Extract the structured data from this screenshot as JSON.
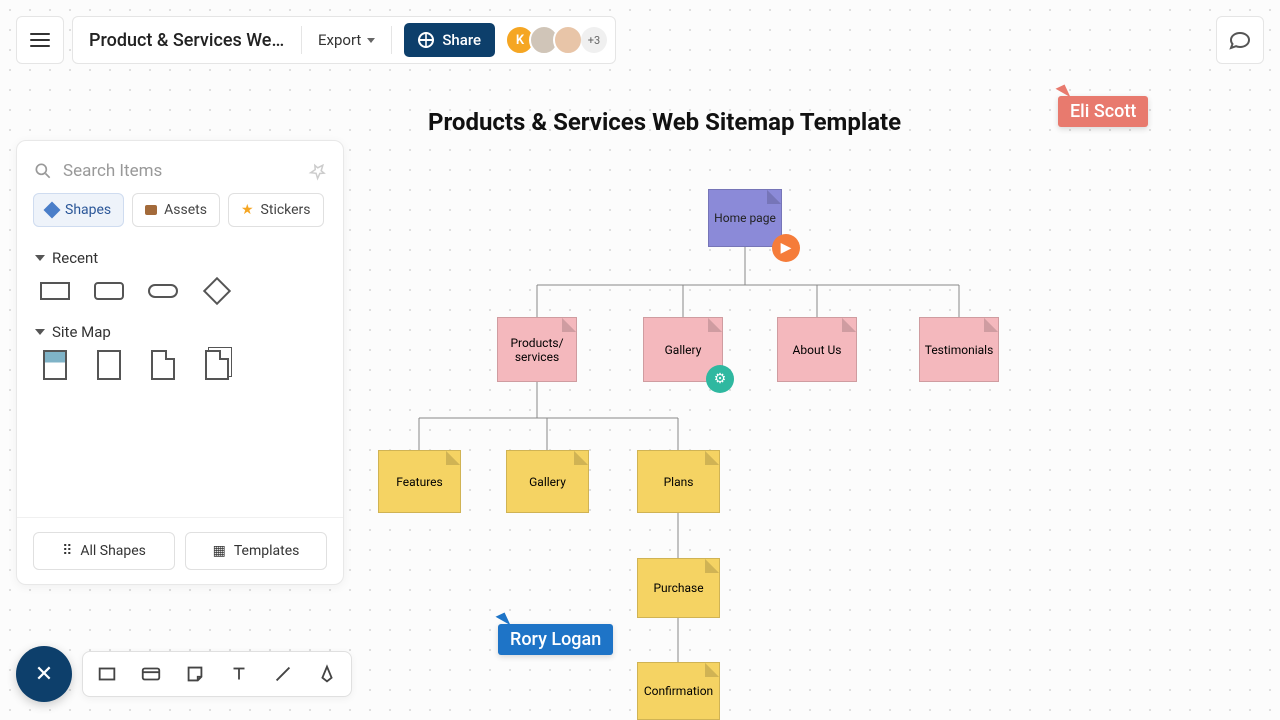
{
  "header": {
    "doc_title": "Product & Services Web...",
    "export_label": "Export",
    "share_label": "Share",
    "avatar_more": "+3",
    "avatar_initial": "K"
  },
  "sidebar": {
    "search_placeholder": "Search Items",
    "tabs": {
      "shapes": "Shapes",
      "assets": "Assets",
      "stickers": "Stickers"
    },
    "sections": {
      "recent": "Recent",
      "sitemap": "Site Map"
    },
    "footer": {
      "all_shapes": "All Shapes",
      "templates": "Templates"
    }
  },
  "canvas": {
    "title": "Products & Services Web Sitemap Template",
    "nodes": {
      "home": "Home page",
      "products": "Products/\nservices",
      "gallery": "Gallery",
      "about": "About Us",
      "testimonials": "Testimonials",
      "features": "Features",
      "gallery2": "Gallery",
      "plans": "Plans",
      "purchase": "Purchase",
      "confirmation": "Confirmation"
    }
  },
  "cursors": {
    "eli": "Eli Scott",
    "rory": "Rory Logan"
  },
  "colors": {
    "purple": "#8b8ad8",
    "pink": "#f4b8bd",
    "yellow": "#f5d363",
    "eli": "#e87a6e",
    "rory": "#1e74c7"
  }
}
